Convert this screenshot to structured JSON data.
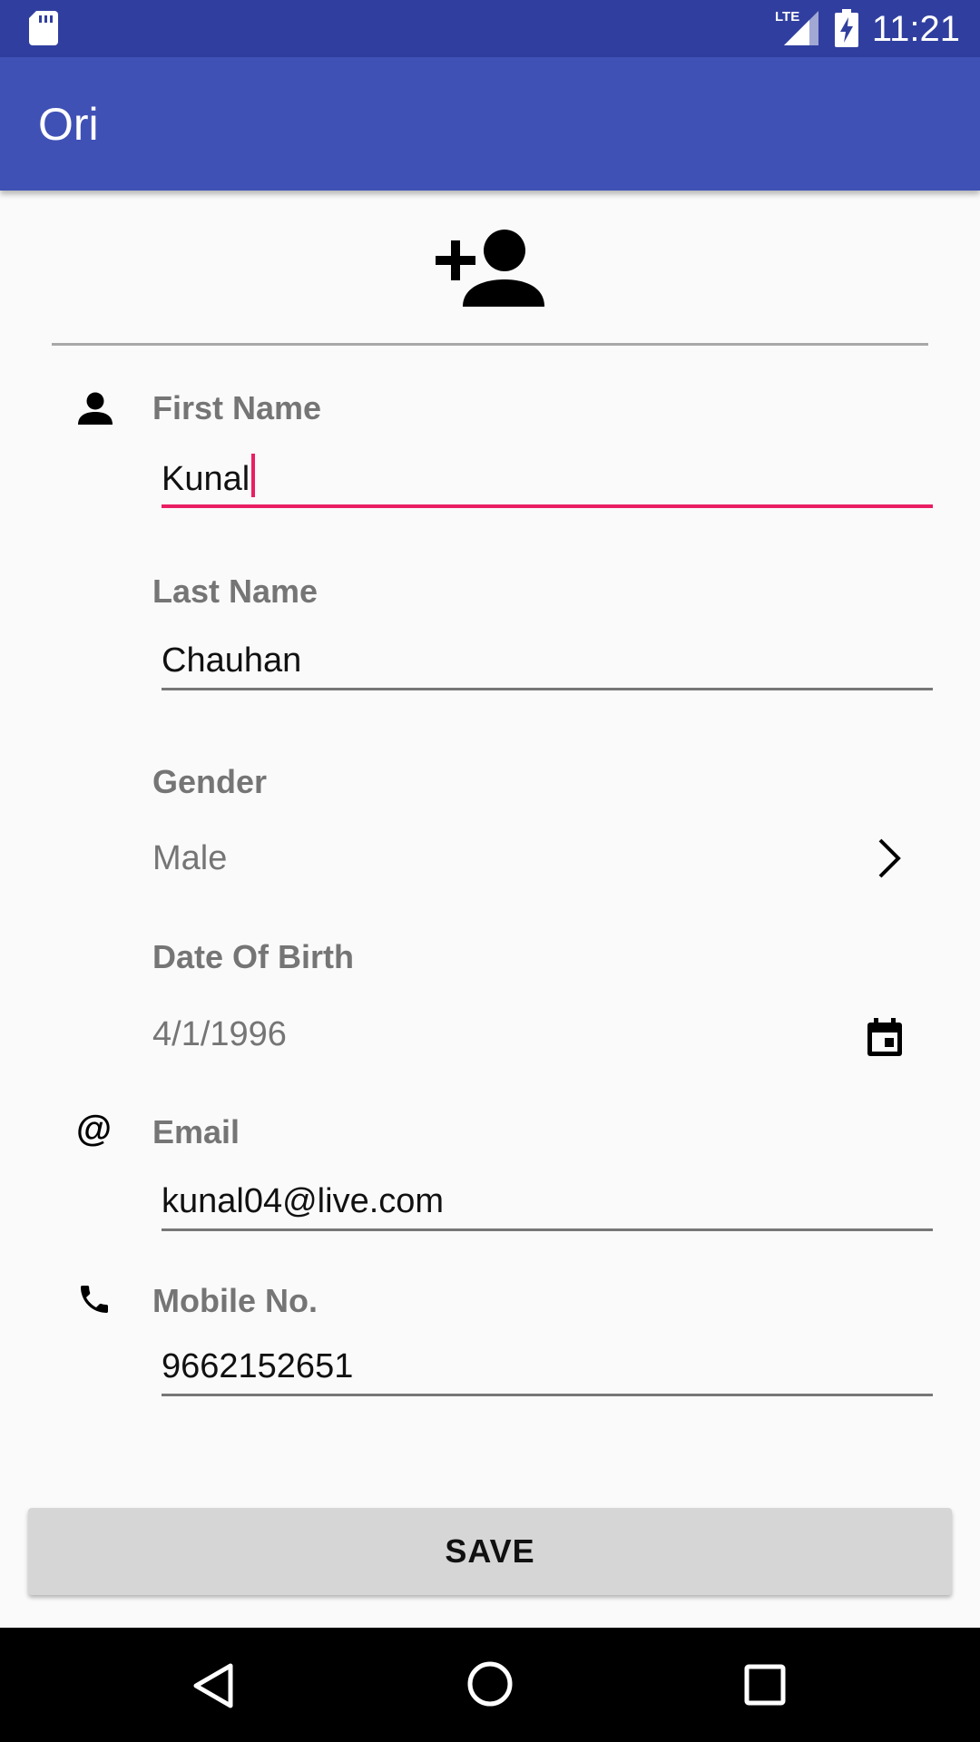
{
  "status_bar": {
    "time": "11:21",
    "network_label": "LTE",
    "icons": [
      "sd-card-icon",
      "lte-signal-icon",
      "battery-charging-icon"
    ]
  },
  "app_bar": {
    "title": "Ori"
  },
  "header": {
    "icon": "person-add-icon"
  },
  "form": {
    "first_name": {
      "label": "First Name",
      "value": "Kunal",
      "icon": "person-icon"
    },
    "last_name": {
      "label": "Last Name",
      "value": "Chauhan"
    },
    "gender": {
      "label": "Gender",
      "value": "Male",
      "icon": "chevron-right-icon"
    },
    "dob": {
      "label": "Date Of Birth",
      "value": "4/1/1996",
      "icon": "calendar-icon"
    },
    "email": {
      "label": "Email",
      "value": "kunal04@live.com",
      "icon": "at-icon"
    },
    "mobile": {
      "label": "Mobile No.",
      "value": "9662152651",
      "icon": "phone-icon"
    }
  },
  "save_button": {
    "label": "SAVE"
  },
  "nav_bar": {
    "icons": [
      "back-icon",
      "home-icon",
      "recents-icon"
    ]
  },
  "colors": {
    "status_bar": "#303f9f",
    "app_bar": "#3f51b5",
    "accent": "#e91e63",
    "label": "#757575"
  }
}
